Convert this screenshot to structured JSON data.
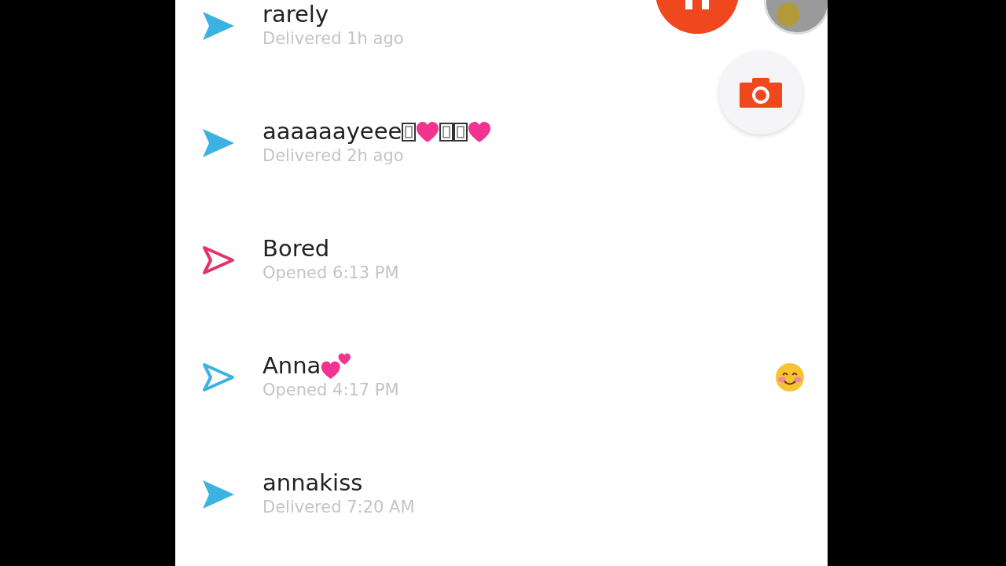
{
  "chats": [
    {
      "name_parts": [
        {
          "kind": "text",
          "text": "rarely"
        }
      ],
      "status": "Delivered 1h ago",
      "opened": false,
      "color": "#3cb2e2",
      "side_emoji": false
    },
    {
      "name_parts": [
        {
          "kind": "text",
          "text": "aaaaaayeee"
        },
        {
          "kind": "tofu"
        },
        {
          "kind": "heart"
        },
        {
          "kind": "tofu"
        },
        {
          "kind": "tofu"
        },
        {
          "kind": "heart"
        }
      ],
      "status": "Delivered 2h ago",
      "opened": false,
      "color": "#3cb2e2",
      "side_emoji": false
    },
    {
      "name_parts": [
        {
          "kind": "text",
          "text": "Bored"
        }
      ],
      "status": "Opened 6:13 PM",
      "opened": true,
      "color": "#e2336b",
      "side_emoji": false
    },
    {
      "name_parts": [
        {
          "kind": "text",
          "text": "Anna"
        },
        {
          "kind": "two_hearts"
        }
      ],
      "status": "Opened 4:17 PM",
      "opened": true,
      "color": "#3cb2e2",
      "side_emoji": true
    },
    {
      "name_parts": [
        {
          "kind": "text",
          "text": "annakiss"
        }
      ],
      "status": "Delivered 7:20 AM",
      "opened": false,
      "color": "#3cb2e2",
      "side_emoji": false
    }
  ]
}
